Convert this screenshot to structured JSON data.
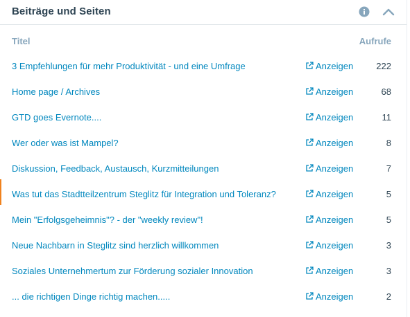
{
  "panel": {
    "title": "Beiträge und Seiten",
    "info_icon": "info-icon",
    "collapse_icon": "chevron-up-icon"
  },
  "columns": {
    "title": "Titel",
    "views": "Aufrufe"
  },
  "view_icon": "external-link-icon",
  "rows": [
    {
      "title": "3 Empfehlungen für mehr Produktivität - und eine Umfrage",
      "view_label": "Anzeigen",
      "count": "222"
    },
    {
      "title": "Home page / Archives",
      "view_label": "Anzeigen",
      "count": "68"
    },
    {
      "title": "GTD goes Evernote....",
      "view_label": "Anzeigen",
      "count": "11"
    },
    {
      "title": "Wer oder was ist Mampel?",
      "view_label": "Anzeigen",
      "count": "8"
    },
    {
      "title": "Diskussion, Feedback, Austausch, Kurzmitteilungen",
      "view_label": "Anzeigen",
      "count": "7"
    },
    {
      "title": "Was tut das Stadtteilzentrum Steglitz für Integration und Toleranz?",
      "view_label": "Anzeigen",
      "count": "5"
    },
    {
      "title": "Mein \"Erfolgsgeheimnis\"? - der \"weekly review\"!",
      "view_label": "Anzeigen",
      "count": "5"
    },
    {
      "title": "Neue Nachbarn in Steglitz sind herzlich willkommen",
      "view_label": "Anzeigen",
      "count": "3"
    },
    {
      "title": "Soziales Unternehmertum zur Förderung sozialer Innovation",
      "view_label": "Anzeigen",
      "count": "3"
    },
    {
      "title": "... die richtigen Dinge richtig machen.....",
      "view_label": "Anzeigen",
      "count": "2"
    }
  ],
  "colors": {
    "accent": "#0087be",
    "title_text": "#2e4453",
    "muted": "#87a6bc",
    "highlight": "#f0821e"
  }
}
